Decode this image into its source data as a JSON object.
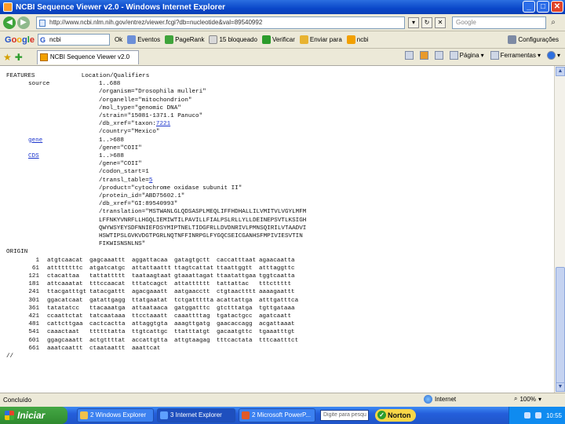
{
  "window": {
    "title": "NCBI Sequence Viewer v2.0 - Windows Internet Explorer"
  },
  "address": {
    "url": "http://www.ncbi.nlm.nih.gov/entrez/viewer.fcgi?db=nucleotide&val=89540992",
    "search_placeholder": "Google"
  },
  "google_toolbar": {
    "query": "ncbi",
    "go_label": "Ok",
    "items": [
      "Eventos",
      "PageRank",
      "15 bloqueado",
      "Verificar",
      "Enviar para",
      "ncbi",
      "Configurações"
    ]
  },
  "tab": {
    "label": "NCBI Sequence Viewer v2.0"
  },
  "commands": {
    "page": "Página",
    "tools": "Ferramentas"
  },
  "record": {
    "features_header": "FEATURES             Location/Qualifiers",
    "source_label": "source",
    "source_qualifiers": [
      "1..688",
      "/organism=\"Drosophila mulleri\"",
      "/organelle=\"mitochondrion\"",
      "/mol_type=\"genomic DNA\"",
      "/strain=\"15081-1371.1 Panuco\"",
      "/db_xref=\"taxon:",
      "/country=\"Mexico\""
    ],
    "taxon_link": "7221",
    "gene_label": "gene",
    "gene_qualifiers": [
      "1..>688",
      "/gene=\"COII\""
    ],
    "cds_label": "CDS",
    "cds_qualifiers": [
      "1..>688",
      "/gene=\"COII\"",
      "/codon_start=1",
      "/transl_table="
    ],
    "transl_table_link": "5",
    "cds_qualifiers_2": [
      "/product=\"cytochrome oxidase subunit II\"",
      "/protein_id=\"ABD75602.1\"",
      "/db_xref=\"GI:89540993\"",
      "/translation=\"MSTWANLGLQDSASPLMEQLIFFHDHALLILVMITVLVGYLMFM",
      "LFFNKYVNRFLLHGQLIEMIWTILPAVILLFIALPSLRLLYLLDEINEPSVTLKSIGH",
      "QWYWSYEYSDFNNIEFDSYMIPTNELTIDGFRLLDVDNRIVLPMNSQIRILVTAADVI",
      "HSWTIPSLGVKVDGTPGRLNQTNFFINRPGLFYGQCSEICGANHSFMPIVIESVTIN",
      "FIKWISNSNLNS\""
    ],
    "origin_label": "ORIGIN",
    "sequence": [
      [
        "1",
        "atgtcaacat",
        "gagcaaattt",
        "aggattacaa",
        "gatagtgctt",
        "caccatttaat",
        "agaacaatta"
      ],
      [
        "61",
        "attttttttc",
        "atgatcatgc",
        "attattaattt",
        "ttagtcattat",
        "ttaattggtt",
        "atttaggttc"
      ],
      [
        "121",
        "ctacattaa",
        "tattattttt",
        "taataagtaat",
        "gtaaattagat",
        "ttaatattgaa",
        "tggtcaatta"
      ],
      [
        "181",
        "attcaaatat",
        "tttccaacat",
        "tttatcagct",
        "attatttttt",
        "tattattac",
        "tttcttttt"
      ],
      [
        "241",
        "ttacgatttgt",
        "tatacgattt",
        "agacgaaatt",
        "aatgaacctt",
        "ctgtaactttt",
        "aaaagaattt"
      ],
      [
        "301",
        "ggacatcaat",
        "gatattgagg",
        "ttatgaatat",
        "tctgattttta",
        "acattattga",
        "atttgatttca"
      ],
      [
        "361",
        "tatatatcc",
        "ttacaaatga",
        "attaataaca",
        "gatggatttc",
        "gtctttatga",
        "tgttgataaa"
      ],
      [
        "421",
        "ccaattctat",
        "tatcaataaa",
        "ttcctaaatt",
        "caaattttag",
        "tgatactgcc",
        "agatcaatt"
      ],
      [
        "481",
        "cattcttgaa",
        "cactcactta",
        "attaggtgta",
        "aaagttgatg",
        "gaacaccagg",
        "acgattaaat"
      ],
      [
        "541",
        "caaactaat",
        "ttttttatta",
        "ttgtcattgc",
        "ttatttatgt",
        "gacaatgttc",
        "tgaaatttgt"
      ],
      [
        "601",
        "ggagcaaatt",
        "actgttttat",
        "accattgtta",
        "attgtaagag",
        "tttcactata",
        "tttcaatttct"
      ],
      [
        "661",
        "aaatcaattt",
        "ctaataattt",
        "aaattcat"
      ]
    ],
    "terminator": "//"
  },
  "status": {
    "left": "Concluído",
    "zone": "Internet",
    "zoom": "100%"
  },
  "taskbar": {
    "start": "Iniciar",
    "tasks": [
      "2 Windows Explorer",
      "3 Internet Explorer",
      "2 Microsoft PowerP..."
    ],
    "search_placeholder": "Digite para pesqu",
    "norton": "Norton",
    "clock": "10:55"
  }
}
